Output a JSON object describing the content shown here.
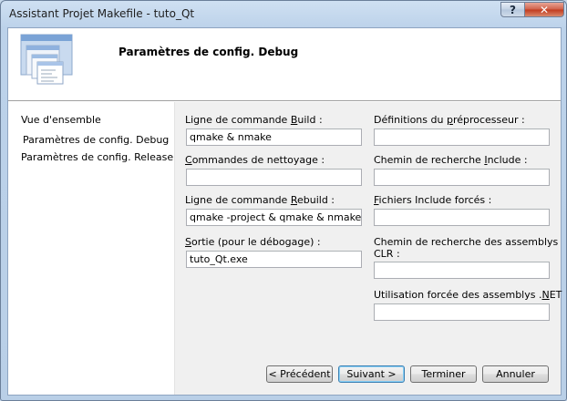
{
  "window": {
    "title": "Assistant Projet Makefile - tuto_Qt",
    "help_label": "?",
    "close_label": "✕"
  },
  "header": {
    "title": "Paramètres de config. Debug"
  },
  "nav": {
    "items": [
      {
        "label": "Vue d'ensemble"
      },
      {
        "label": "Paramètres de config. Debug",
        "selected": true
      },
      {
        "label": "Paramètres de config. Release"
      }
    ]
  },
  "form": {
    "left": [
      {
        "label_pre": "Ligne de commande ",
        "label_key": "B",
        "label_post": "uild :",
        "value": "qmake & nmake"
      },
      {
        "label_pre": "",
        "label_key": "C",
        "label_post": "ommandes de nettoyage :",
        "value": ""
      },
      {
        "label_pre": "Ligne de commande ",
        "label_key": "R",
        "label_post": "ebuild :",
        "value": "qmake -project & qmake & nmake"
      },
      {
        "label_pre": "",
        "label_key": "S",
        "label_post": "ortie (pour le débogage) :",
        "value": "tuto_Qt.exe"
      }
    ],
    "right": [
      {
        "label_pre": "Définitions du ",
        "label_key": "p",
        "label_post": "réprocesseur :",
        "value": ""
      },
      {
        "label_pre": "Chemin de recherche ",
        "label_key": "I",
        "label_post": "nclude :",
        "value": ""
      },
      {
        "label_pre": "",
        "label_key": "F",
        "label_post": "ichiers Include forcés :",
        "value": ""
      },
      {
        "label_pre": "Chemin de recherche des assemblys",
        "label_key": "",
        "label_post": "",
        "label_line2": "CLR :",
        "value": ""
      },
      {
        "label_pre": "Utilisation forcée des assemblys .",
        "label_key": "N",
        "label_post": "ET :",
        "value": ""
      }
    ]
  },
  "buttons": {
    "previous": "< Précédent",
    "next": "Suivant >",
    "finish": "Terminer",
    "cancel": "Annuler"
  },
  "colors": {
    "window_frame": "#b9cfe7",
    "client_bg": "#f0f0f0",
    "header_bg": "#ffffff",
    "close_red": "#c1391c"
  }
}
